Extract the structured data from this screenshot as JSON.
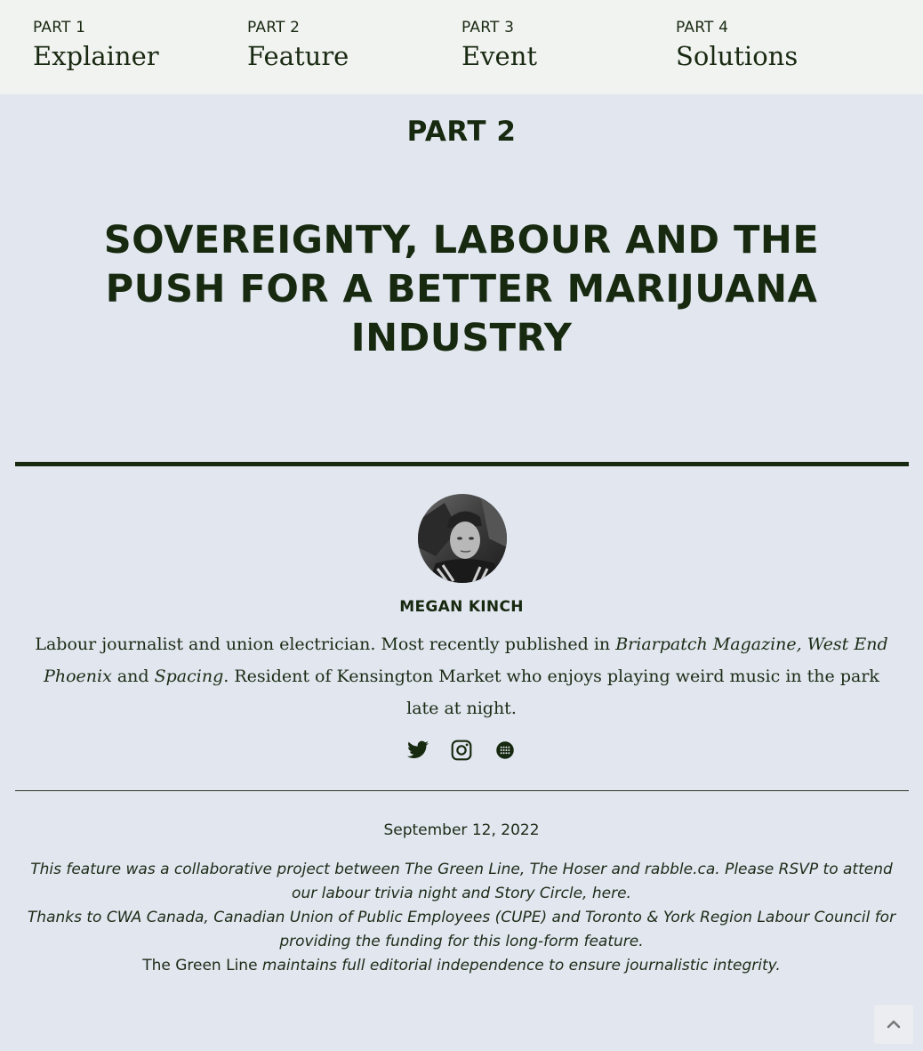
{
  "nav": {
    "parts": [
      {
        "num": "PART 1",
        "name": "Explainer"
      },
      {
        "num": "PART 2",
        "name": "Feature"
      },
      {
        "num": "PART 3",
        "name": "Event"
      },
      {
        "num": "PART 4",
        "name": "Solutions"
      }
    ]
  },
  "article": {
    "eyebrow": "PART 2",
    "headline": "SOVEREIGNTY, LABOUR AND THE PUSH FOR A BETTER MARIJUANA INDUSTRY"
  },
  "author": {
    "name": "MEGAN KINCH",
    "bio_1": "Labour journalist and union electrician. Most recently published in ",
    "bio_pubs": "Briarpatch Magazine, West End Phoenix",
    "bio_and": " and ",
    "bio_spacing": "Spacing",
    "bio_2": ". Resident of Kensington Market who enjoys playing weird music in the park late at night.",
    "socials": [
      "twitter-icon",
      "instagram-icon",
      "website-icon"
    ]
  },
  "meta": {
    "date": "September 12, 2022",
    "note_1": "This feature was a collaborative project between The Green Line, The Hoser and rabble.ca. Please RSVP to attend our labour trivia night and Story Circle, here.",
    "note_2": "Thanks to CWA Canada, Canadian Union of Public Employees (CUPE) and Toronto & York Region Labour Council for providing the funding for this long-form feature.",
    "note_3_plain": "The Green Line",
    "note_3_italic": " maintains full editorial independence to ensure journalistic integrity."
  },
  "colors": {
    "ink": "#17290f",
    "page_bg": "#e1e6ef",
    "nav_bg": "#f1f3f1"
  }
}
